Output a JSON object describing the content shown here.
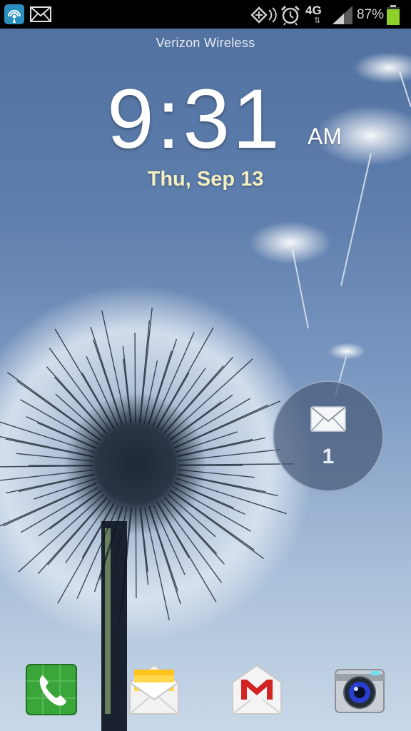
{
  "status_bar": {
    "icons_left": [
      "hotspot-icon",
      "envelope-icon"
    ],
    "icons_right": [
      "data-sync-icon",
      "alarm-icon",
      "4g-lte-icon",
      "signal-icon",
      "battery-icon"
    ],
    "network": "4G",
    "battery_percent": "87%",
    "battery_level": 0.87,
    "battery_color": "#8fd12a"
  },
  "lockscreen": {
    "carrier": "Verizon Wireless",
    "time": "9:31",
    "ampm": "AM",
    "date": "Thu, Sep 13"
  },
  "notification": {
    "icon": "envelope-icon",
    "count": "1"
  },
  "dock": {
    "apps": [
      "phone-icon",
      "messaging-icon",
      "gmail-icon",
      "camera-icon"
    ]
  },
  "colors": {
    "date_text": "#f3efc0",
    "sky": "#5f7fae"
  }
}
